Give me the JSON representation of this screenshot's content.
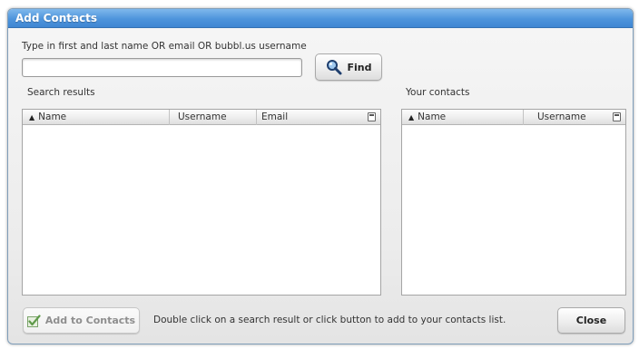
{
  "dialog": {
    "title": "Add Contacts",
    "accent_color": "#4e94dc"
  },
  "search": {
    "instruction": "Type in first and last name OR email OR bubbl.us username",
    "value": "",
    "placeholder": "",
    "find_label": "Find",
    "find_icon": "magnifier-icon"
  },
  "results": {
    "label": "Search results",
    "columns": [
      "Name",
      "Username",
      "Email"
    ],
    "sort_column": "Name",
    "rows": []
  },
  "contacts": {
    "label": "Your contacts",
    "columns": [
      "Name",
      "Username"
    ],
    "sort_column": "Name",
    "rows": []
  },
  "footer": {
    "add_label": "Add to Contacts",
    "add_icon": "add-contact-check-icon",
    "hint": "Double click on a search result or click button to add to your contacts list.",
    "close_label": "Close"
  }
}
